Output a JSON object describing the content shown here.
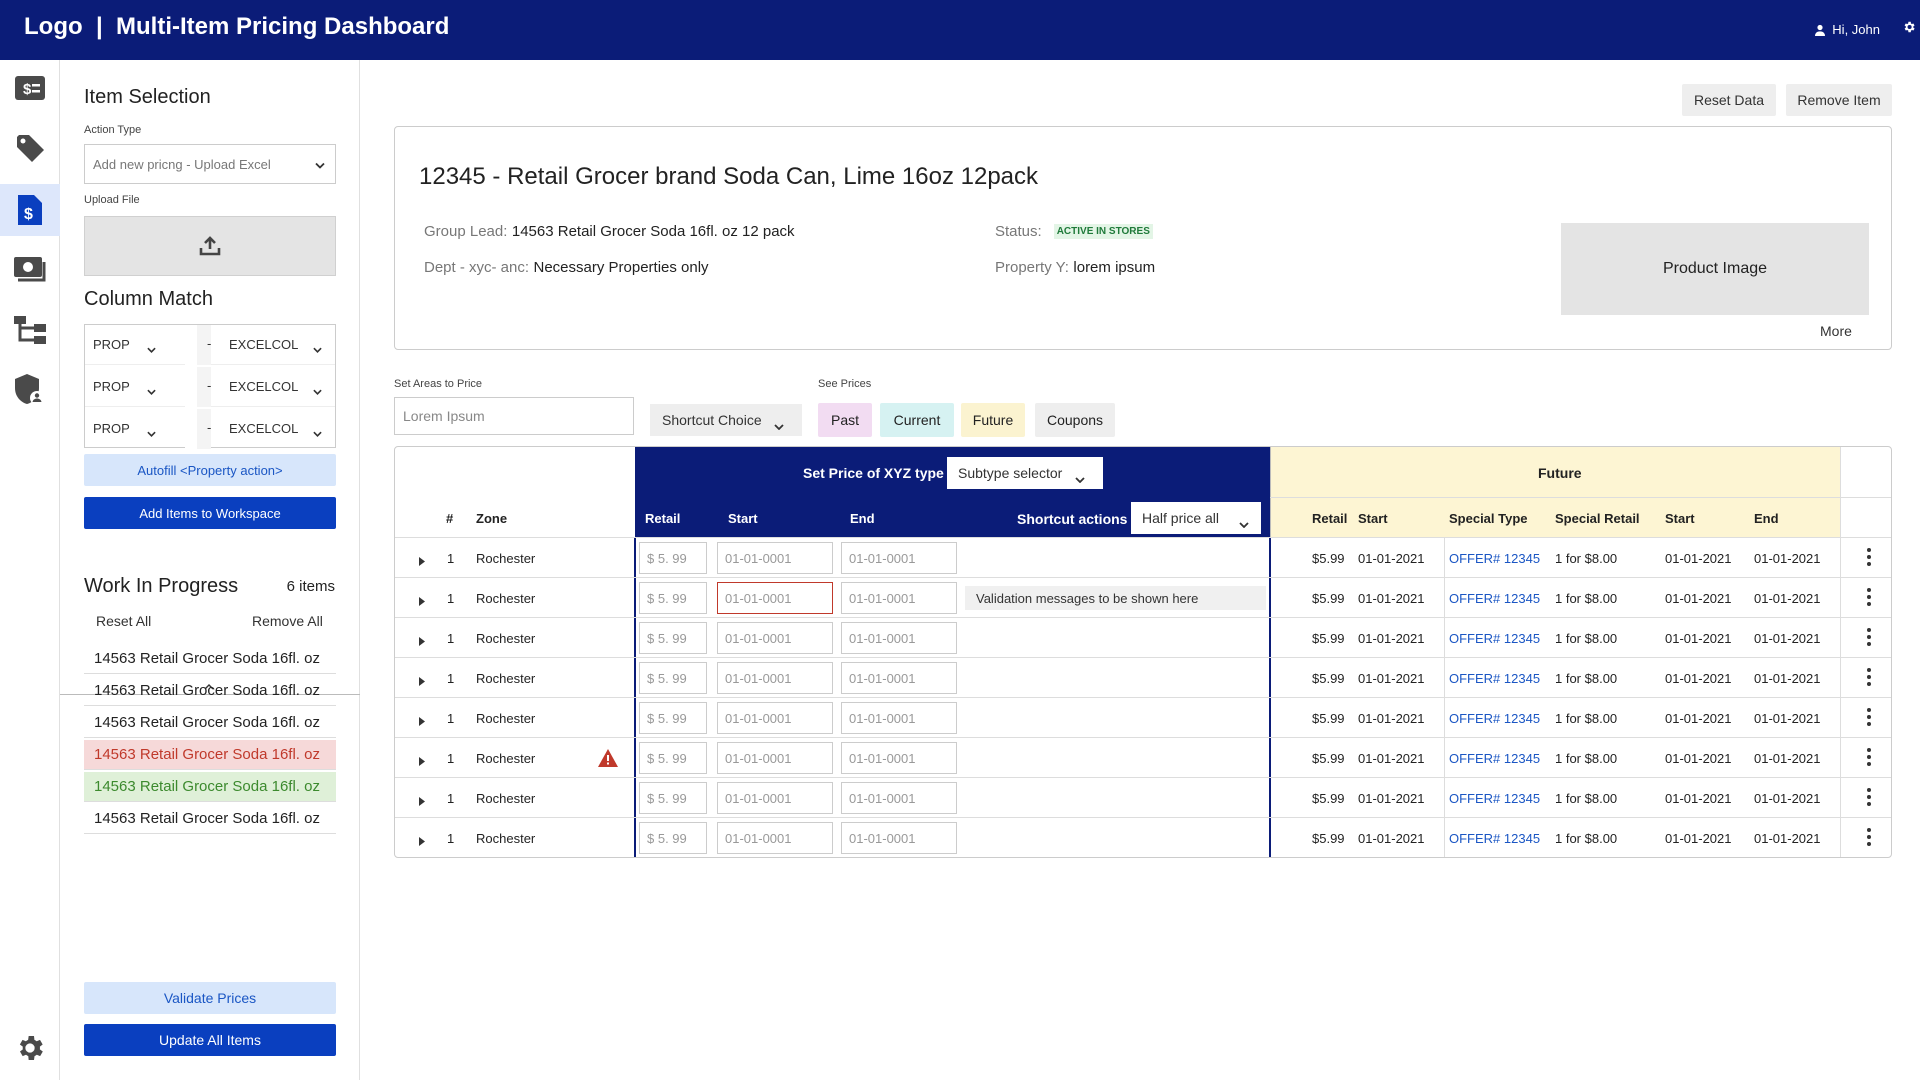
{
  "header": {
    "title": "Logo  |  Multi-Item Pricing Dashboard",
    "user": "Hi, John"
  },
  "rail": {
    "icons": [
      "pricing-icon",
      "tag-icon",
      "price-doc-icon",
      "cash-icon",
      "hierarchy-icon",
      "shield-user-icon",
      "settings-icon"
    ]
  },
  "left": {
    "item_selection": "Item Selection",
    "action_type_label": "Action Type",
    "action_type_value": "Add new pricng - Upload Excel",
    "upload_label": "Upload File",
    "column_match": "Column Match",
    "matches": [
      {
        "prop": "PROP",
        "dash": "-",
        "col": "EXCELCOL"
      },
      {
        "prop": "PROP",
        "dash": "-",
        "col": "EXCELCOL"
      },
      {
        "prop": "PROP",
        "dash": "-",
        "col": "EXCELCOL"
      }
    ],
    "autofill": "Autofill <Property action>",
    "add_items": "Add Items to Workspace",
    "wip_title": "Work In Progress",
    "wip_count": "6 items",
    "reset_all": "Reset All",
    "remove_all": "Remove All",
    "wip_items": [
      {
        "text": "14563 Retail Grocer Soda 16fl. oz",
        "state": "normal"
      },
      {
        "text": "14563 Retail Grocer Soda 16fl. oz",
        "state": "normal"
      },
      {
        "text": "14563 Retail Grocer Soda 16fl. oz",
        "state": "normal"
      },
      {
        "text": "14563 Retail Grocer Soda 16fl. oz",
        "state": "error"
      },
      {
        "text": "14563 Retail Grocer Soda 16fl. oz",
        "state": "success"
      },
      {
        "text": "14563 Retail Grocer Soda 16fl. oz",
        "state": "normal"
      }
    ],
    "validate": "Validate Prices",
    "update_all": "Update All Items"
  },
  "top_actions": {
    "reset": "Reset Data",
    "remove": "Remove Item"
  },
  "product": {
    "title": "12345 - Retail Grocer brand Soda Can, Lime 16oz 12pack",
    "group_lead_k": "Group Lead:",
    "group_lead_v": "14563 Retail Grocer Soda 16fl. oz 12 pack",
    "dept_k": "Dept - xyc- anc:",
    "dept_v": "Necessary Properties only",
    "status_k": "Status:",
    "status_v": "ACTIVE IN STORES",
    "prop_k": "Property Y:",
    "prop_v": "lorem ipsum",
    "image": "Product Image",
    "more": "More"
  },
  "filters": {
    "areas_label": "Set Areas to Price",
    "areas_placeholder": "Lorem Ipsum",
    "shortcut": "Shortcut Choice",
    "see_prices": "See Prices",
    "chips": [
      "Past",
      "Current",
      "Future",
      "Coupons"
    ]
  },
  "grid": {
    "set_price": "Set Price of XYZ type",
    "subtype": "Subtype selector",
    "future": "Future",
    "h_num": "#",
    "h_zone": "Zone",
    "h_retail": "Retail",
    "h_start": "Start",
    "h_end": "End",
    "h_shortcut": "Shortcut actions",
    "h_half": "Half price all",
    "f_retail": "Retail",
    "f_start": "Start",
    "f_special_type": "Special Type",
    "f_special_retail": "Special Retail",
    "f_start2": "Start",
    "f_end": "End",
    "validation": "Validation messages to be shown here",
    "rows": [
      {
        "num": "1",
        "zone": "Rochester",
        "retail": "$ 5. 99",
        "start": "01-01-0001",
        "end": "01-01-0001",
        "warn": false,
        "err": false,
        "fr": "$5.99",
        "fs": "01-01-2021",
        "offer": "OFFER# 12345",
        "sr": "1 for $8.00",
        "s2": "01-01-2021",
        "e2": "01-01-2021"
      },
      {
        "num": "1",
        "zone": "Rochester",
        "retail": "$ 5. 99",
        "start": "01-01-0001",
        "end": "01-01-0001",
        "warn": false,
        "err": true,
        "fr": "$5.99",
        "fs": "01-01-2021",
        "offer": "OFFER# 12345",
        "sr": "1 for $8.00",
        "s2": "01-01-2021",
        "e2": "01-01-2021"
      },
      {
        "num": "1",
        "zone": "Rochester",
        "retail": "$ 5. 99",
        "start": "01-01-0001",
        "end": "01-01-0001",
        "warn": false,
        "err": false,
        "fr": "$5.99",
        "fs": "01-01-2021",
        "offer": "OFFER# 12345",
        "sr": "1 for $8.00",
        "s2": "01-01-2021",
        "e2": "01-01-2021"
      },
      {
        "num": "1",
        "zone": "Rochester",
        "retail": "$ 5. 99",
        "start": "01-01-0001",
        "end": "01-01-0001",
        "warn": false,
        "err": false,
        "fr": "$5.99",
        "fs": "01-01-2021",
        "offer": "OFFER# 12345",
        "sr": "1 for $8.00",
        "s2": "01-01-2021",
        "e2": "01-01-2021"
      },
      {
        "num": "1",
        "zone": "Rochester",
        "retail": "$ 5. 99",
        "start": "01-01-0001",
        "end": "01-01-0001",
        "warn": false,
        "err": false,
        "fr": "$5.99",
        "fs": "01-01-2021",
        "offer": "OFFER# 12345",
        "sr": "1 for $8.00",
        "s2": "01-01-2021",
        "e2": "01-01-2021"
      },
      {
        "num": "1",
        "zone": "Rochester",
        "retail": "$ 5. 99",
        "start": "01-01-0001",
        "end": "01-01-0001",
        "warn": true,
        "err": false,
        "fr": "$5.99",
        "fs": "01-01-2021",
        "offer": "OFFER# 12345",
        "sr": "1 for $8.00",
        "s2": "01-01-2021",
        "e2": "01-01-2021"
      },
      {
        "num": "1",
        "zone": "Rochester",
        "retail": "$ 5. 99",
        "start": "01-01-0001",
        "end": "01-01-0001",
        "warn": false,
        "err": false,
        "fr": "$5.99",
        "fs": "01-01-2021",
        "offer": "OFFER# 12345",
        "sr": "1 for $8.00",
        "s2": "01-01-2021",
        "e2": "01-01-2021"
      },
      {
        "num": "1",
        "zone": "Rochester",
        "retail": "$ 5. 99",
        "start": "01-01-0001",
        "end": "01-01-0001",
        "warn": false,
        "err": false,
        "fr": "$5.99",
        "fs": "01-01-2021",
        "offer": "OFFER# 12345",
        "sr": "1 for $8.00",
        "s2": "01-01-2021",
        "e2": "01-01-2021"
      }
    ]
  },
  "colors": {
    "navy": "#0b1c78",
    "primary": "#0a3fbf",
    "light": "#d7e6fb",
    "error_bg": "#f6d9d9",
    "error_fg": "#c0392b",
    "success_bg": "#dff0d8",
    "success_fg": "#3c8a2e",
    "future_bg": "#fdf5d3",
    "past": "#f0d8f0",
    "current": "#d5f1f1",
    "future_chip": "#fbf3d0"
  }
}
